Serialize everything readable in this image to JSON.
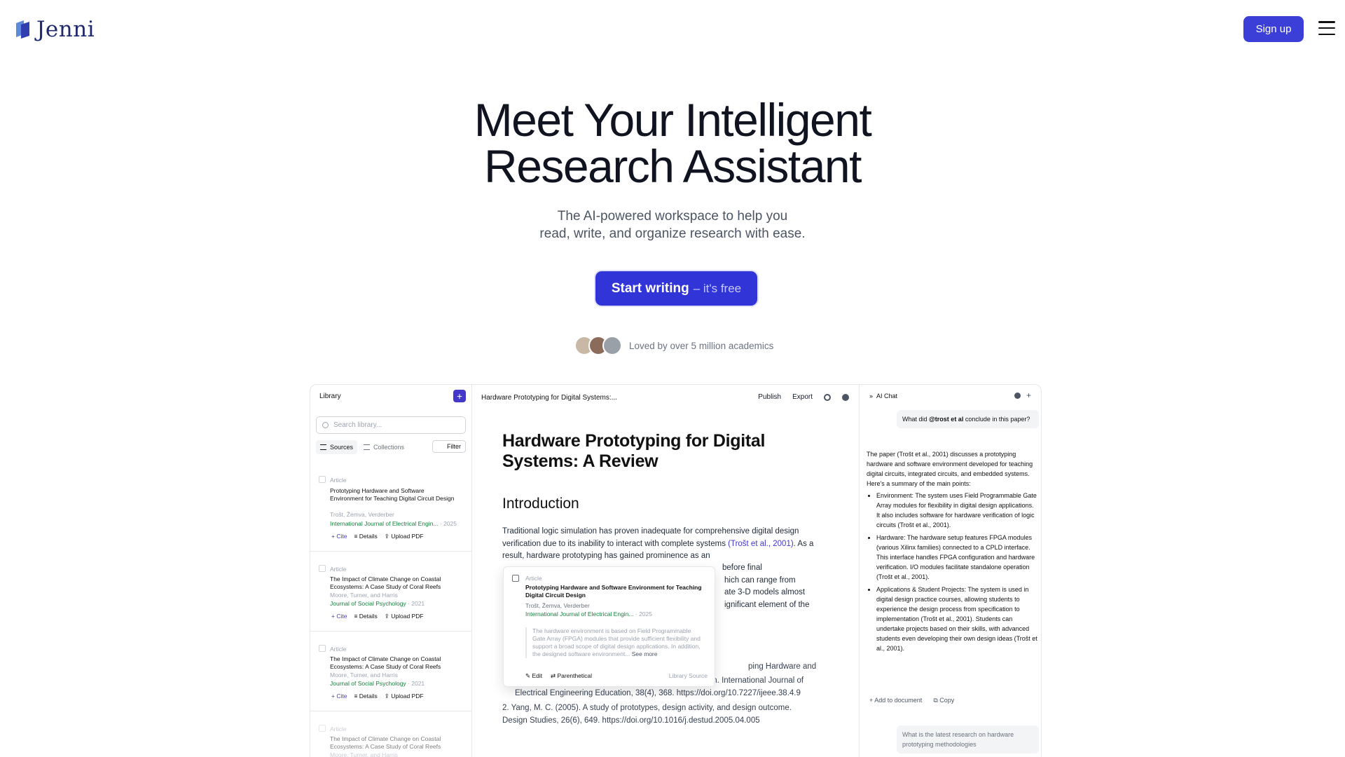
{
  "header": {
    "brand": "Jenni",
    "signup_label": "Sign up",
    "brand_color": "#3b3fd8"
  },
  "hero": {
    "title_line1": "Meet Your Intelligent",
    "title_line2": "Research Assistant",
    "subtitle_line1": "The AI-powered workspace to help you",
    "subtitle_line2": "read, write, and organize research with ease.",
    "cta_main": "Start writing",
    "cta_secondary": "– it's free",
    "social_proof": "Loved by over 5 million academics"
  },
  "library": {
    "title": "Library",
    "search_placeholder": "Search library...",
    "tab_sources": "Sources",
    "tab_collections": "Collections",
    "filter": "Filter",
    "cards": [
      {
        "type": "Article",
        "title": "Prototyping Hardware and Software Environment for Teaching Digital Circuit Design",
        "authors": "Trošt, Žemva, Verderber",
        "journal": "International Journal of Electrical Engin...",
        "year": "· 2025",
        "cite": "Cite",
        "details": "Details",
        "upload": "Upload PDF"
      },
      {
        "type": "Article",
        "title": "The Impact of Climate Change on Coastal Ecosystems: A Case Study of Coral Reefs",
        "authors": "Moore, Turner, and Harris",
        "journal": "Journal of Social Psychology",
        "year": "· 2021",
        "cite": "Cite",
        "details": "Details",
        "upload": "Upload PDF"
      },
      {
        "type": "Article",
        "title": "The Impact of Climate Change on Coastal Ecosystems: A Case Study of Coral Reefs",
        "authors": "Moore, Turner, and Harris",
        "journal": "Journal of Social Psychology",
        "year": "· 2021",
        "cite": "Cite",
        "details": "Details",
        "upload": "Upload PDF"
      },
      {
        "type": "Article",
        "title": "The Impact of Climate Change on Coastal Ecosystems: A Case Study of Coral Reefs",
        "authors": "Moore, Turner, and Harris"
      }
    ]
  },
  "editor": {
    "doc_title": "Hardware Prototyping for Digital Systems:...",
    "publish": "Publish",
    "export": "Export",
    "heading": "Hardware Prototyping for Digital Systems: A Review",
    "section": "Introduction",
    "para_start": "Traditional logic simulation has proven inadequate for comprehensive digital design verification due to its inability to interact with complete systems ",
    "para_ref": "(Trošt et al., 2001)",
    "para_cont": ". As a result, hardware prototyping has gained prominence as an",
    "tail_1": "before final",
    "tail_2": "hich can range from",
    "tail_3": "ate 3-D models almost",
    "tail_4": "ignificant element of the",
    "ref1_tail": "ping Hardware and",
    "ref1_rest": "Software Environment for Teaching Digital Circuit Design. International Journal of Electrical Engineering Education, 38(4), 368. https://doi.org/10.7227/ijeee.38.4.9",
    "ref2": "2.  Yang, M. C. (2005). A study of prototypes, design activity, and design outcome. Design Studies, 26(6), 649. https://doi.org/10.1016/j.destud.2005.04.005"
  },
  "popover": {
    "type": "Article",
    "title": "Prototyping Hardware and Software Environment for Teaching Digital Circuit Design",
    "authors": "Trošt, Žemva, Verderber",
    "journal": "International Journal of Electrical Engin...",
    "year": "· 2025",
    "abstract": "The hardware environment is based on Field Programmable Gate Array (FPGA) modules that provide sufficient flexibility and support a broad scope of digital design applications. In addition, the designed software environment...",
    "see_more": "See more",
    "edit": "Edit",
    "parenthetical": "Parenthetical",
    "source": "Library Source"
  },
  "chat": {
    "title": "AI Chat",
    "q1_pre": "What did ",
    "q1_bold": "@trost et al",
    "q1_post": " conclude in this paper?",
    "answer_intro": "The paper (Trošt et al., 2001) discusses a prototyping hardware and software environment developed for teaching digital circuits, integrated circuits, and embedded systems. Here's a summary of the main points:",
    "points": [
      "Environment: The system uses Field Programmable Gate Array modules for flexibility in digital design applications. It also includes software for hardware verification of logic circuits (Trošt et al., 2001).",
      "Hardware: The hardware setup features FPGA modules (various Xilinx families) connected to a CPLD interface. This interface handles FPGA configuration and hardware verification. I/O modules facilitate standalone operation (Trošt et al., 2001).",
      "Applications & Student Projects: The system is used in digital design practice courses, allowing students to experience the design process from specification to implementation (Trošt et al., 2001). Students can undertake projects based on their skills, with advanced students even developing their own design ideas (Trošt et al., 2001)."
    ],
    "add_to_doc": "Add to document",
    "copy": "Copy",
    "q2": "What is the latest research on hardware prototyping methodologies"
  }
}
